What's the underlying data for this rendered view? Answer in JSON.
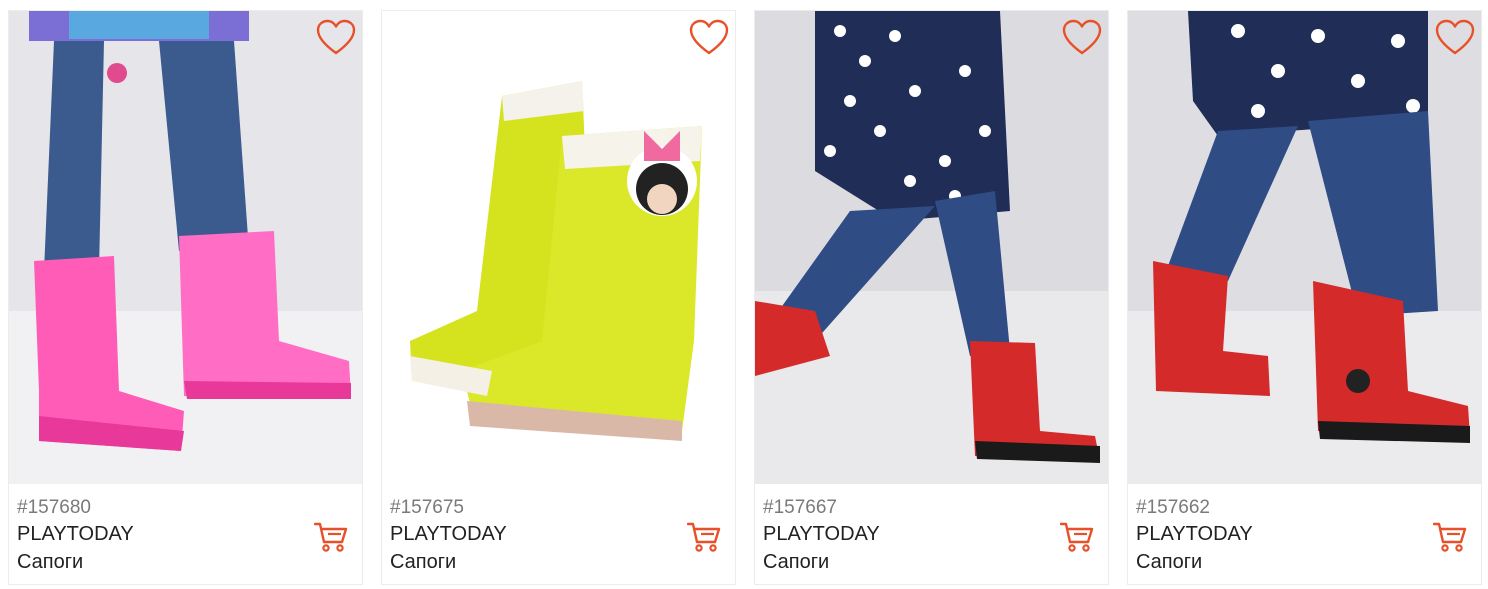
{
  "accent_color": "#e8502a",
  "products": [
    {
      "sku": "#157680",
      "brand": "PLAYTODAY",
      "name": "Сапоги",
      "image": "pink-glitter-rain-boots-photo",
      "favorite_icon": "heart-outline-icon",
      "cart_icon": "shopping-cart-icon"
    },
    {
      "sku": "#157675",
      "brand": "PLAYTODAY",
      "name": "Сапоги",
      "image": "yellow-minnie-rain-boots-photo",
      "favorite_icon": "heart-outline-icon",
      "cart_icon": "shopping-cart-icon"
    },
    {
      "sku": "#157667",
      "brand": "PLAYTODAY",
      "name": "Сапоги",
      "image": "red-polka-dot-minnie-boots-photo",
      "favorite_icon": "heart-outline-icon",
      "cart_icon": "shopping-cart-icon"
    },
    {
      "sku": "#157662",
      "brand": "PLAYTODAY",
      "name": "Сапоги",
      "image": "red-polka-dot-minnie-boots-photo-2",
      "favorite_icon": "heart-outline-icon",
      "cart_icon": "shopping-cart-icon"
    }
  ]
}
